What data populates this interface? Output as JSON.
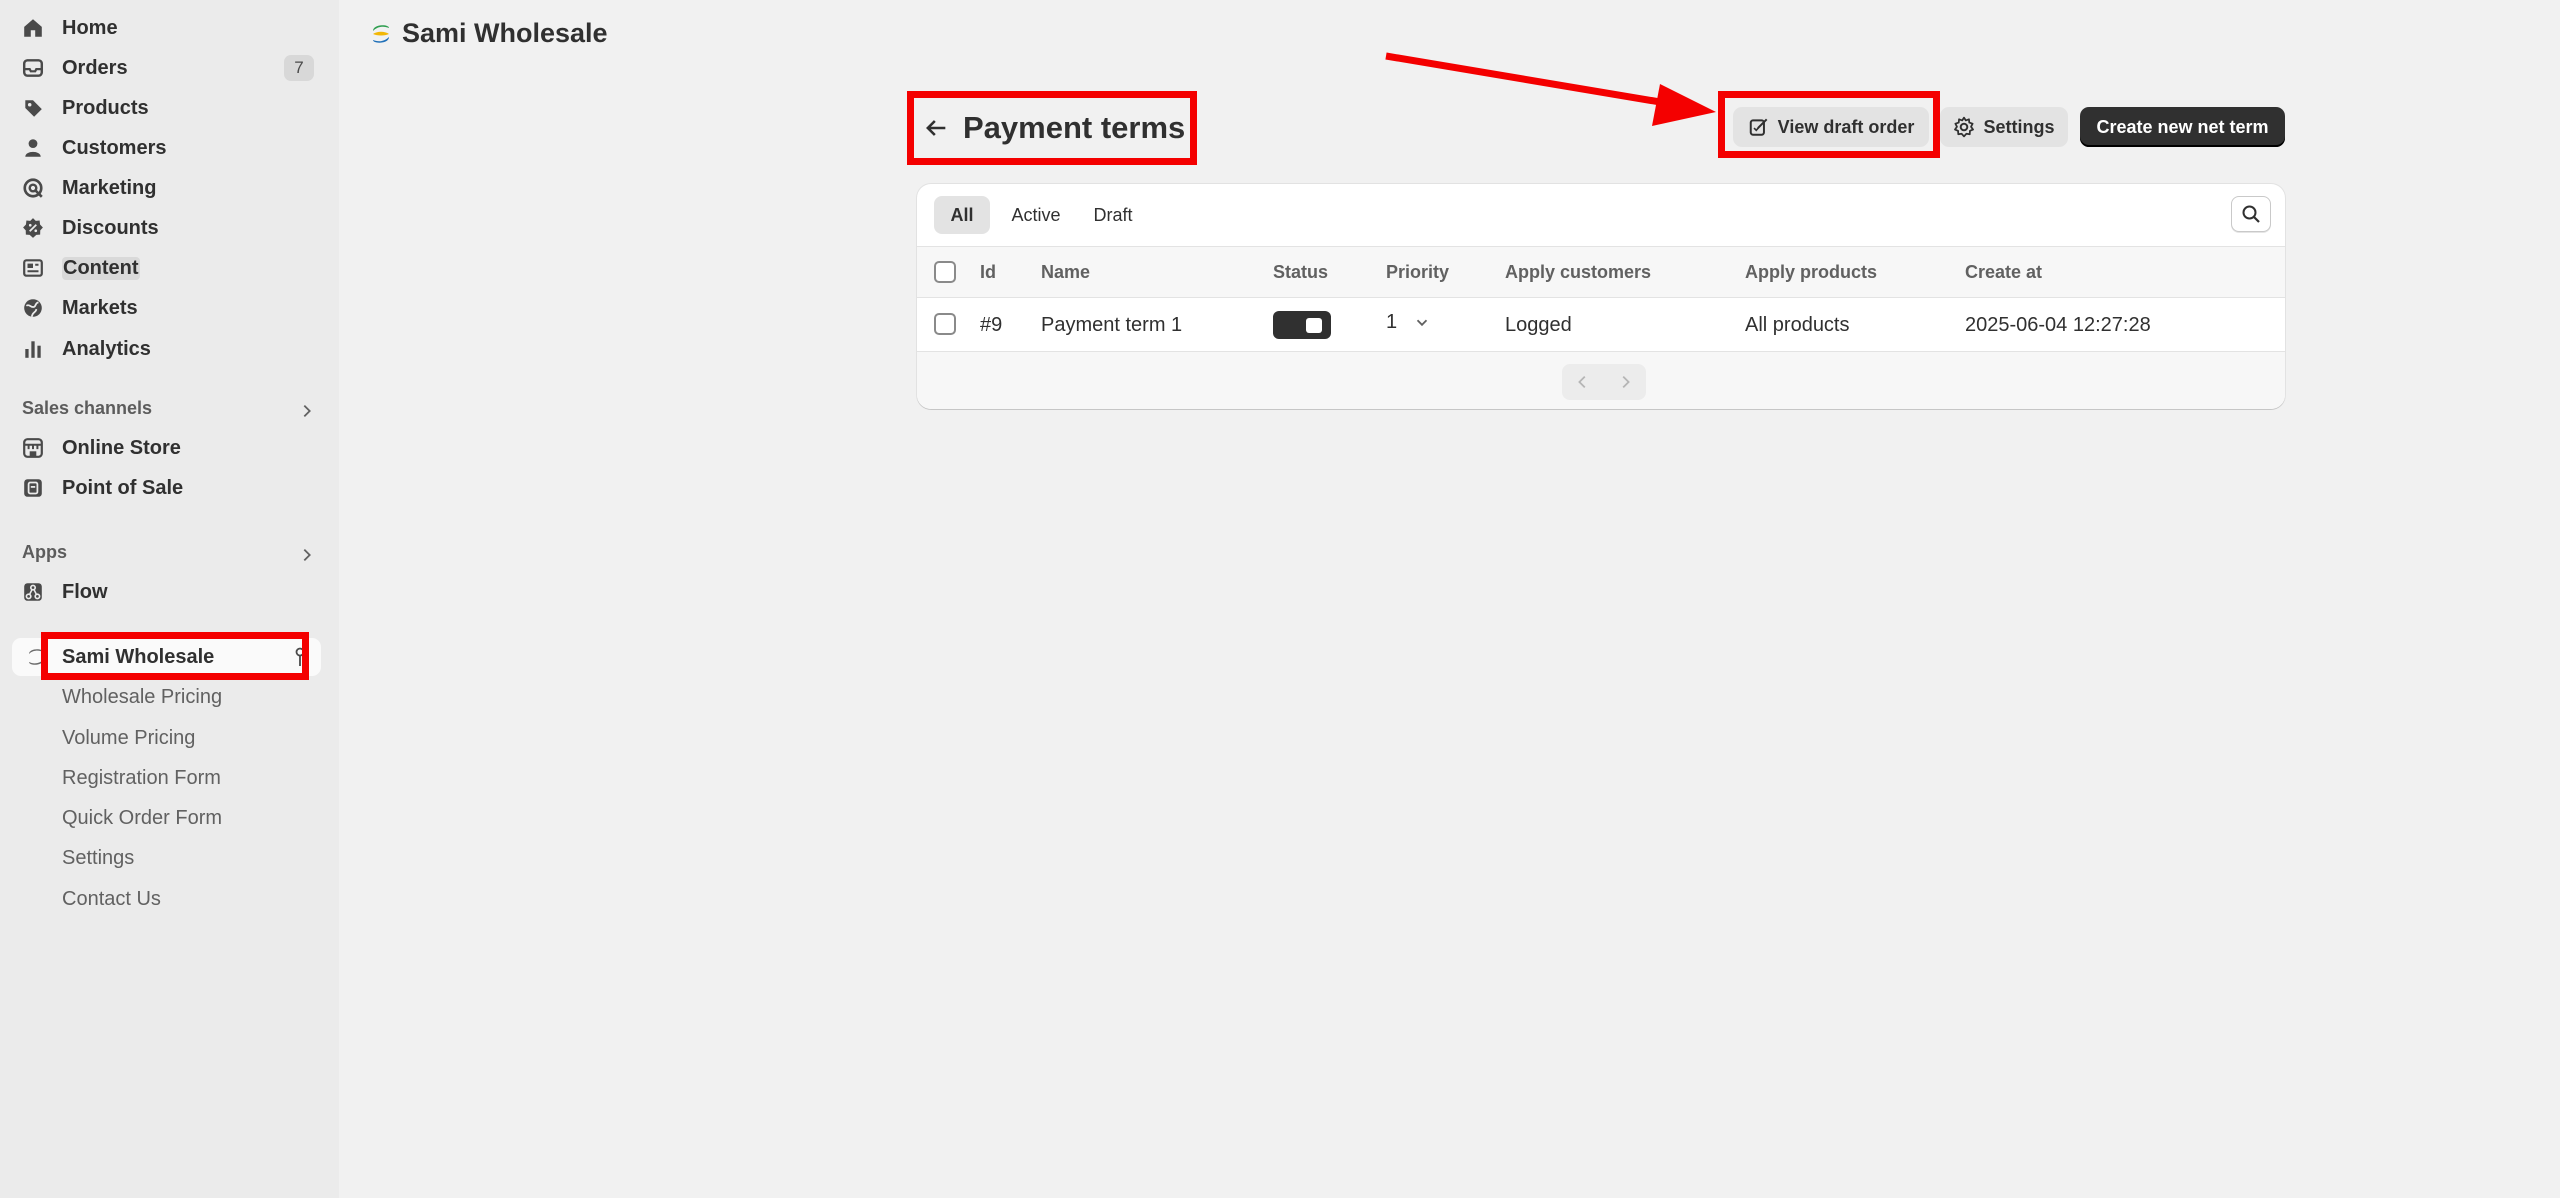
{
  "app": {
    "store_name": "Sami Wholesale"
  },
  "sidebar": {
    "items": [
      {
        "label": "Home",
        "icon": "home-icon"
      },
      {
        "label": "Orders",
        "icon": "orders-icon",
        "badge": "7"
      },
      {
        "label": "Products",
        "icon": "tag-icon"
      },
      {
        "label": "Customers",
        "icon": "person-icon"
      },
      {
        "label": "Marketing",
        "icon": "marketing-icon"
      },
      {
        "label": "Discounts",
        "icon": "discount-icon"
      },
      {
        "label": "Content",
        "icon": "content-icon"
      },
      {
        "label": "Markets",
        "icon": "globe-icon"
      },
      {
        "label": "Analytics",
        "icon": "bar-chart-icon"
      }
    ],
    "sales_channels": {
      "title": "Sales channels",
      "items": [
        {
          "label": "Online Store",
          "icon": "store-icon"
        },
        {
          "label": "Point of Sale",
          "icon": "pos-icon"
        }
      ]
    },
    "apps": {
      "title": "Apps",
      "items": [
        {
          "label": "Flow",
          "icon": "flow-icon"
        }
      ]
    },
    "app_section": {
      "label": "Sami Wholesale",
      "sub_items": [
        "Wholesale Pricing",
        "Volume Pricing",
        "Registration Form",
        "Quick Order Form",
        "Settings",
        "Contact Us"
      ]
    }
  },
  "header": {
    "title": "Payment terms",
    "view_draft_label": "View draft order",
    "settings_label": "Settings",
    "create_label": "Create new net term"
  },
  "tabs": [
    "All",
    "Active",
    "Draft"
  ],
  "table": {
    "columns": [
      "Id",
      "Name",
      "Status",
      "Priority",
      "Apply customers",
      "Apply products",
      "Create at"
    ],
    "rows": [
      {
        "id": "#9",
        "name": "Payment term 1",
        "status": "active",
        "priority": "1",
        "apply_customers": "Logged",
        "apply_products": "All products",
        "created_at": "2025-06-04 12:27:28"
      }
    ]
  },
  "colors": {
    "annotation": "#f40000",
    "primary_button": "#303030",
    "sidebar_bg": "#ebebeb",
    "page_bg": "#f1f1f1"
  }
}
